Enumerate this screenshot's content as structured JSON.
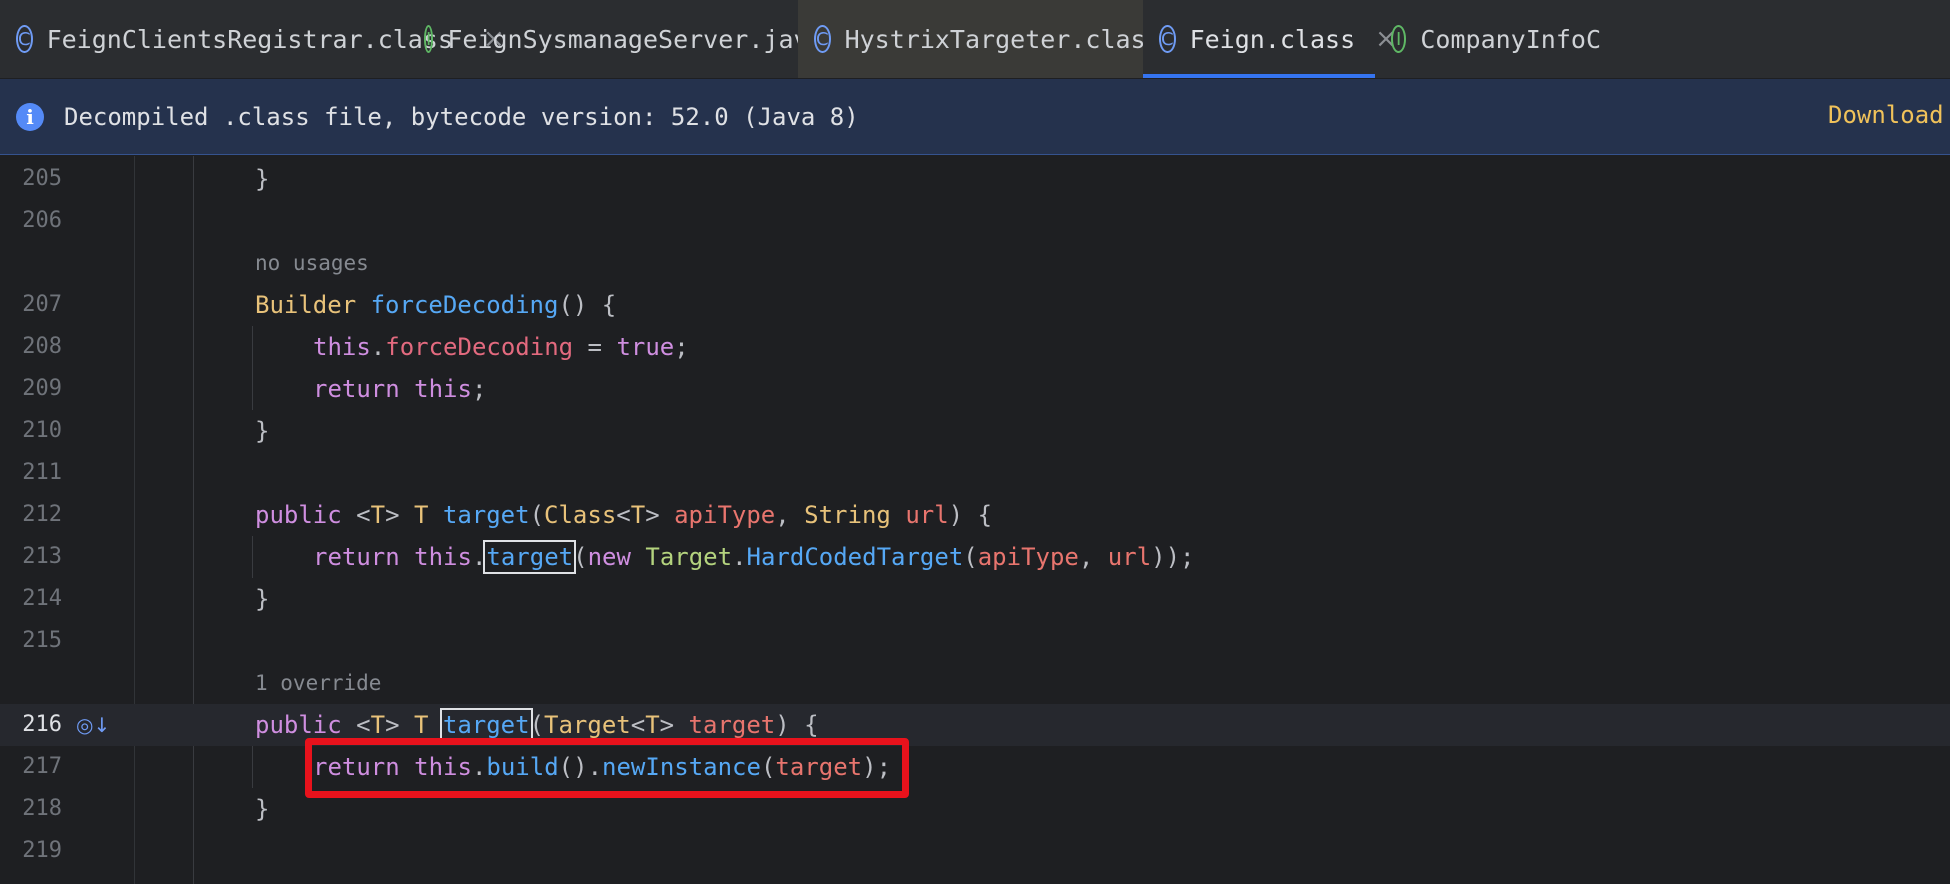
{
  "tabs": [
    {
      "label": "FeignClientsRegistrar.class",
      "icon": "C",
      "kind": "class",
      "closable": true
    },
    {
      "label": "FeignSysmanageServer.java",
      "icon": "I",
      "kind": "interface",
      "closable": false
    },
    {
      "label": "HystrixTargeter.class",
      "icon": "C",
      "kind": "class",
      "closable": false
    },
    {
      "label": "Feign.class",
      "icon": "C",
      "kind": "class",
      "closable": true,
      "active": true
    },
    {
      "label": "CompanyInfoC",
      "icon": "I",
      "kind": "interface",
      "closable": false
    }
  ],
  "close_glyph": "×",
  "infobar": {
    "icon": "i",
    "message": "Decompiled .class file, bytecode version: 52.0 (Java 8)",
    "action": "Download"
  },
  "code": {
    "ln_205": "205",
    "ln_206": "206",
    "ln_207": "207",
    "ln_208": "208",
    "ln_209": "209",
    "ln_210": "210",
    "ln_211": "211",
    "ln_212": "212",
    "ln_213": "213",
    "ln_214": "214",
    "ln_215": "215",
    "ln_216": "216",
    "ln_217": "217",
    "ln_218": "218",
    "ln_219": "219",
    "hint_no_usages": "no usages",
    "hint_override": "1 override",
    "brace_close": "}",
    "t_builder": "Builder",
    "t_forceDecoding_fn": "forceDecoding",
    "t_paren_brace": "() {",
    "t_this": "this",
    "t_dot": ".",
    "t_forceDecoding_field": "forceDecoding",
    "t_assign": " = ",
    "t_true": "true",
    "t_semi": ";",
    "t_return": "return",
    "t_public": "public",
    "t_lt": "<",
    "t_T": "T",
    "t_gt": ">",
    "t_target": "target",
    "t_open": "(",
    "t_Class": "Class",
    "t_apiType": "apiType",
    "t_comma": ", ",
    "t_String": "String",
    "t_url": "url",
    "t_close_brace": ") {",
    "t_new": "new",
    "t_Target": "Target",
    "t_HardCodedTarget": "HardCodedTarget",
    "t_close_close_semi": "));",
    "t_build": "build",
    "t_parens": "()",
    "t_newInstance": "newInstance",
    "t_close_semi": ");"
  },
  "colors": {
    "keyword": "#cf8ee0",
    "type": "#e8c27a",
    "method": "#56a8f5",
    "field": "#e36a7f",
    "highlight_box": "#e8121c",
    "active_tab_underline": "#3574f0"
  },
  "gutter_icon": "overridden-method-icon"
}
